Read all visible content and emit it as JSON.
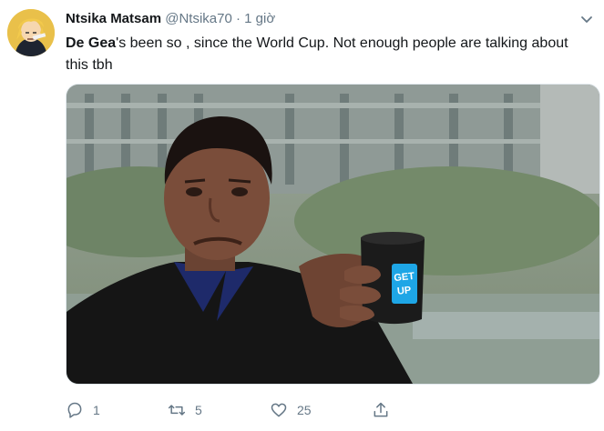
{
  "author": {
    "display_name": "Ntsika Matsam",
    "handle": "@Ntsika70",
    "separator": "·",
    "time": "1 giờ"
  },
  "tweet": {
    "text_bold": "De Gea",
    "text_rest": "'s been so ,       since the World Cup. Not enough people are talking about this tbh"
  },
  "media": {
    "mug_text": "GET UP"
  },
  "actions": {
    "reply_count": "1",
    "retweet_count": "5",
    "like_count": "25"
  },
  "icons": [
    "avatar",
    "chevron-down-icon",
    "reply-icon",
    "retweet-icon",
    "like-icon",
    "share-icon"
  ],
  "colors": {
    "text": "#14171a",
    "secondary": "#657786",
    "accent": "#1da1f2"
  }
}
